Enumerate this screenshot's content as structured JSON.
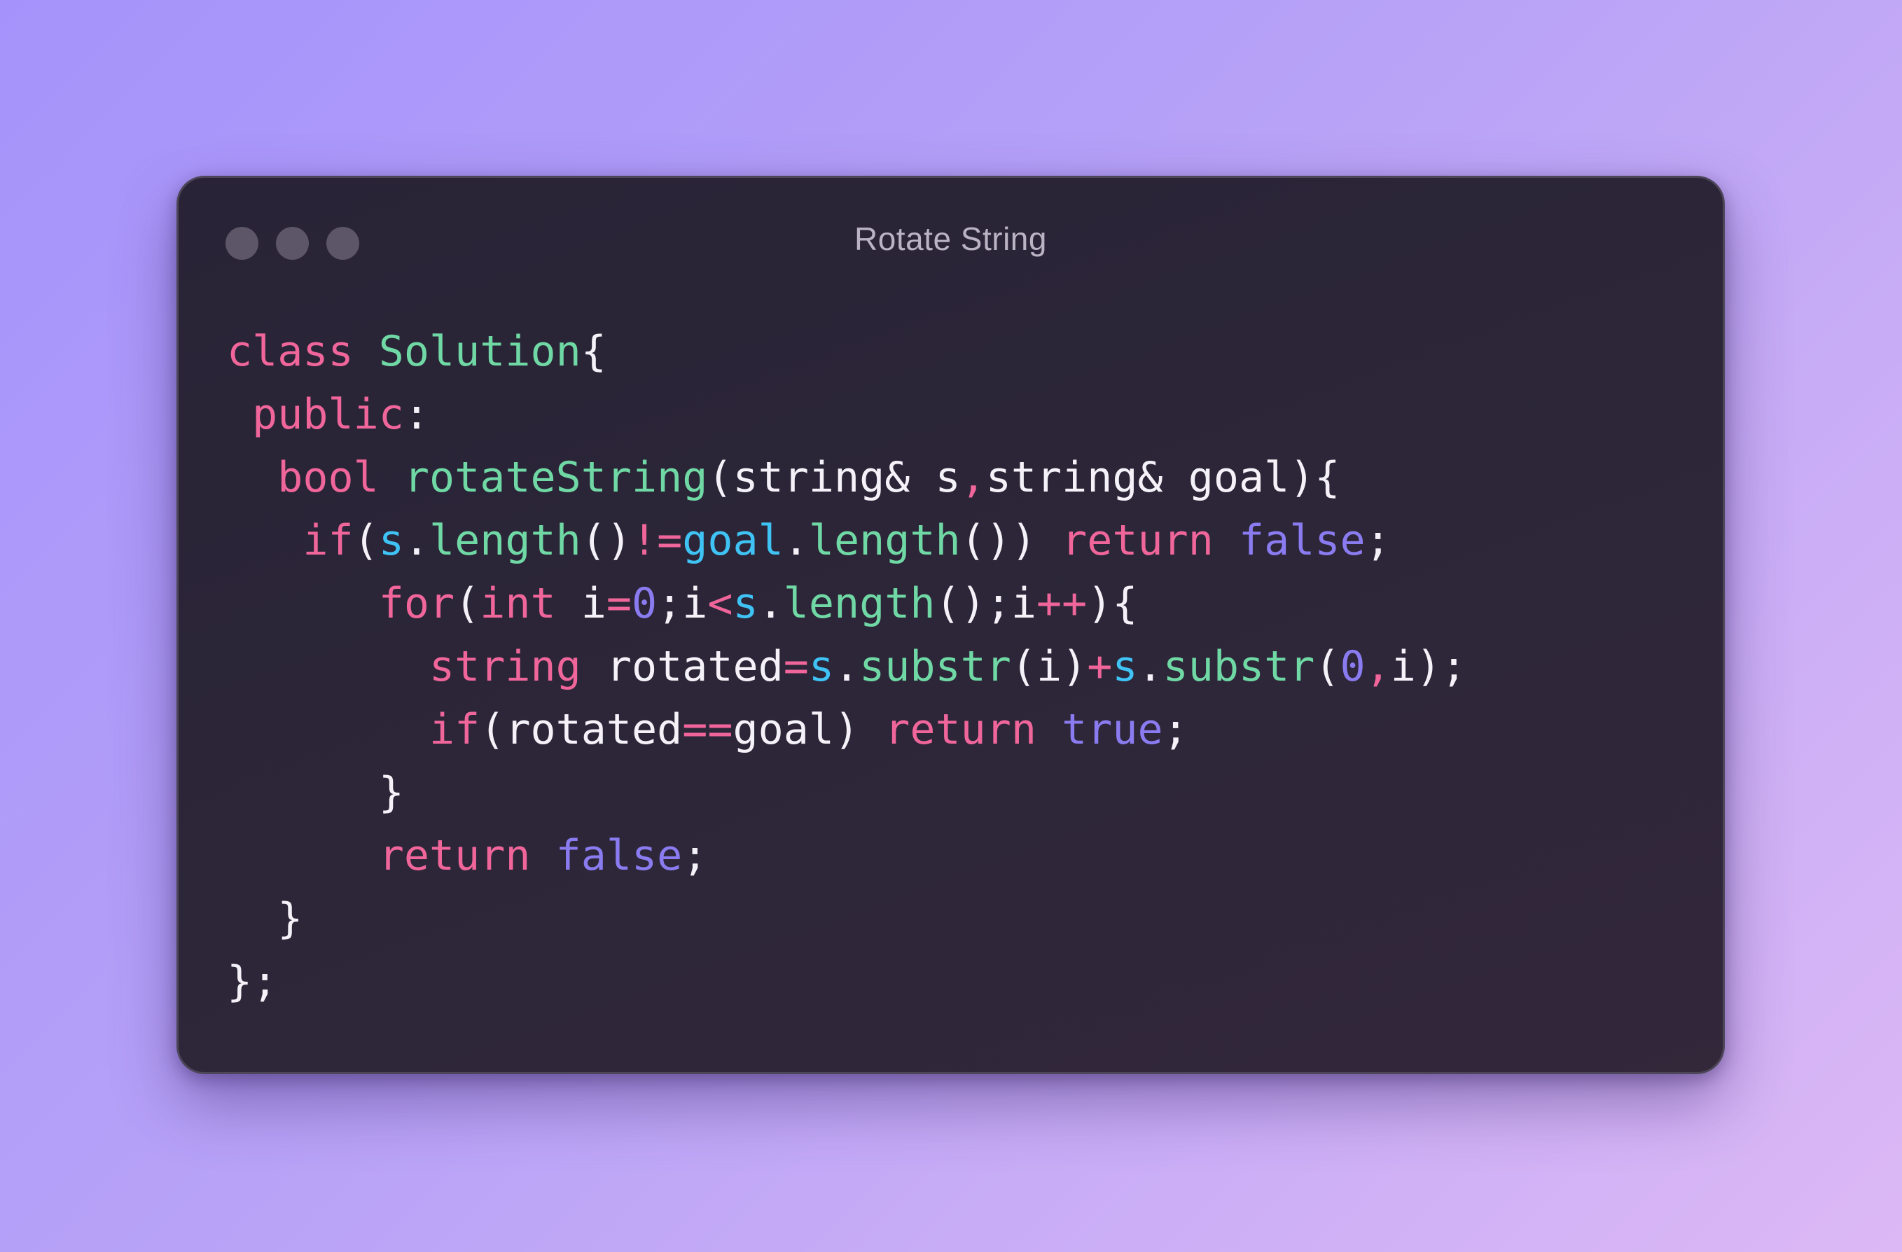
{
  "window": {
    "title": "Rotate String",
    "controls": [
      "close-dot",
      "minimize-dot",
      "maximize-dot"
    ]
  },
  "colors": {
    "keyword": "#f0669b",
    "function": "#6fd8a4",
    "object": "#3fc3f5",
    "number": "#8a7cf0",
    "boolean": "#8a7cf0",
    "operator": "#f0669b",
    "plain": "#f4f2f8",
    "window_background": "#2d2639",
    "page_gradient": [
      "#a593fb",
      "#dcb8f5"
    ]
  },
  "code": {
    "language": "cpp",
    "lines": [
      {
        "indent": "",
        "tokens": [
          [
            "kw",
            "class"
          ],
          [
            "plain",
            " "
          ],
          [
            "fn",
            "Solution"
          ],
          [
            "plain",
            "{"
          ]
        ]
      },
      {
        "indent": " ",
        "tokens": [
          [
            "kw",
            "public"
          ],
          [
            "plain",
            ":"
          ]
        ]
      },
      {
        "indent": "  ",
        "tokens": [
          [
            "kw",
            "bool"
          ],
          [
            "plain",
            " "
          ],
          [
            "fn",
            "rotateString"
          ],
          [
            "plain",
            "(string& s"
          ],
          [
            "op",
            ","
          ],
          [
            "plain",
            "string& goal){"
          ]
        ]
      },
      {
        "indent": "   ",
        "tokens": [
          [
            "kw",
            "if"
          ],
          [
            "plain",
            "("
          ],
          [
            "obj",
            "s"
          ],
          [
            "plain",
            "."
          ],
          [
            "fn",
            "length"
          ],
          [
            "plain",
            "()"
          ],
          [
            "op",
            "!="
          ],
          [
            "obj",
            "goal"
          ],
          [
            "plain",
            "."
          ],
          [
            "fn",
            "length"
          ],
          [
            "plain",
            "()) "
          ],
          [
            "kw",
            "return"
          ],
          [
            "plain",
            " "
          ],
          [
            "bool",
            "false"
          ],
          [
            "plain",
            ";"
          ]
        ]
      },
      {
        "indent": "      ",
        "tokens": [
          [
            "kw",
            "for"
          ],
          [
            "plain",
            "("
          ],
          [
            "kw",
            "int"
          ],
          [
            "plain",
            " i"
          ],
          [
            "op",
            "="
          ],
          [
            "num",
            "0"
          ],
          [
            "plain",
            ";i"
          ],
          [
            "op",
            "<"
          ],
          [
            "obj",
            "s"
          ],
          [
            "plain",
            "."
          ],
          [
            "fn",
            "length"
          ],
          [
            "plain",
            "();i"
          ],
          [
            "op",
            "++"
          ],
          [
            "plain",
            "){"
          ]
        ]
      },
      {
        "indent": "        ",
        "tokens": [
          [
            "kw",
            "string"
          ],
          [
            "plain",
            " rotated"
          ],
          [
            "op",
            "="
          ],
          [
            "obj",
            "s"
          ],
          [
            "plain",
            "."
          ],
          [
            "fn",
            "substr"
          ],
          [
            "plain",
            "(i)"
          ],
          [
            "op",
            "+"
          ],
          [
            "obj",
            "s"
          ],
          [
            "plain",
            "."
          ],
          [
            "fn",
            "substr"
          ],
          [
            "plain",
            "("
          ],
          [
            "num",
            "0"
          ],
          [
            "op",
            ","
          ],
          [
            "plain",
            "i);"
          ]
        ]
      },
      {
        "indent": "        ",
        "tokens": [
          [
            "kw",
            "if"
          ],
          [
            "plain",
            "(rotated"
          ],
          [
            "op",
            "=="
          ],
          [
            "plain",
            "goal) "
          ],
          [
            "kw",
            "return"
          ],
          [
            "plain",
            " "
          ],
          [
            "bool",
            "true"
          ],
          [
            "plain",
            ";"
          ]
        ]
      },
      {
        "indent": "      ",
        "tokens": [
          [
            "plain",
            "}"
          ]
        ]
      },
      {
        "indent": "      ",
        "tokens": [
          [
            "kw",
            "return"
          ],
          [
            "plain",
            " "
          ],
          [
            "bool",
            "false"
          ],
          [
            "plain",
            ";"
          ]
        ]
      },
      {
        "indent": "  ",
        "tokens": [
          [
            "plain",
            "}"
          ]
        ]
      },
      {
        "indent": "",
        "tokens": [
          [
            "plain",
            "};"
          ]
        ]
      }
    ]
  }
}
